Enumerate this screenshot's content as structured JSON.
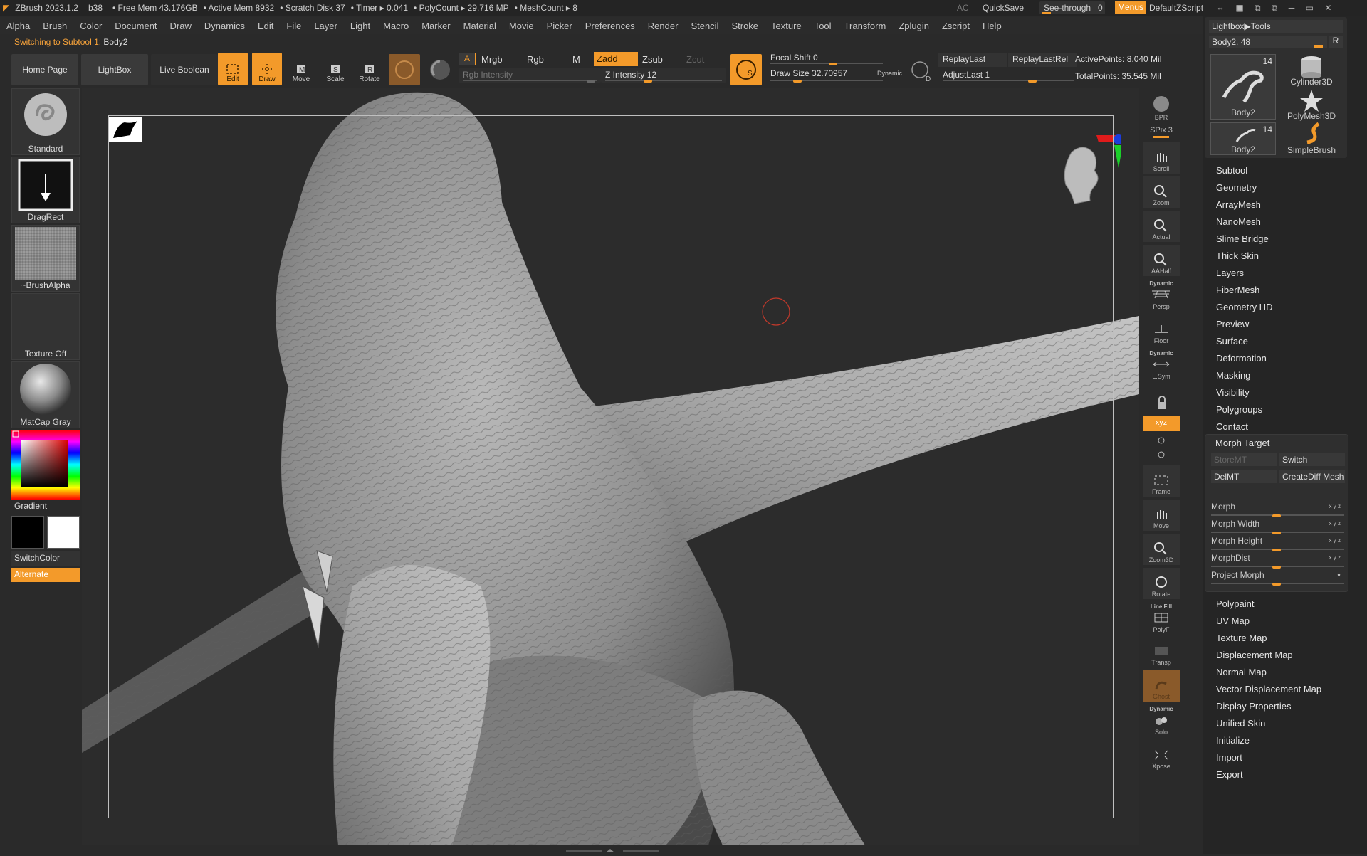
{
  "titlebar": {
    "app": "ZBrush 2023.1.2",
    "build": "b38",
    "free_mem": "• Free Mem 43.176GB",
    "active_mem": "• Active Mem 8932",
    "scratch": "• Scratch Disk 37",
    "timer": "• Timer ▸ 0.041",
    "polycount": "• PolyCount ▸ 29.716 MP",
    "meshcount": "• MeshCount ▸ 8",
    "ac": "AC",
    "quicksave": "QuickSave",
    "seethrough": "See-through",
    "seethrough_value": "0",
    "menus": "Menus",
    "script": "DefaultZScript"
  },
  "menubar": [
    "Alpha",
    "Brush",
    "Color",
    "Document",
    "Draw",
    "Dynamics",
    "Edit",
    "File",
    "Layer",
    "Light",
    "Macro",
    "Marker",
    "Material",
    "Movie",
    "Picker",
    "Preferences",
    "Render",
    "Stencil",
    "Stroke",
    "Texture",
    "Tool",
    "Transform",
    "Zplugin",
    "Zscript",
    "Help"
  ],
  "notice": {
    "text": "Switching to Subtool 1:",
    "subtool": "Body2"
  },
  "toolbar": {
    "home": "Home Page",
    "lightbox": "LightBox",
    "liveboolean": "Live Boolean",
    "edit": "Edit",
    "draw": "Draw",
    "move": "Move",
    "scale": "Scale",
    "rotate": "Rotate",
    "a": "A",
    "mrgb": "Mrgb",
    "rgb": "Rgb",
    "m": "M",
    "rgb_intensity": "Rgb Intensity",
    "zadd": "Zadd",
    "zsub": "Zsub",
    "zcut": "Zcut",
    "z_intensity": "Z Intensity 12",
    "focal_shift": "Focal Shift 0",
    "draw_size": "Draw Size 32.70957",
    "dynamic": "Dynamic",
    "replaylast": "ReplayLast",
    "replaylastrel": "ReplayLastRel",
    "adjustlast": "AdjustLast 1",
    "activepoints": "ActivePoints: 8.040 Mil",
    "totalpoints": "TotalPoints: 35.545 Mil",
    "accent": "#f39a2a"
  },
  "leftshelf": {
    "standard": "Standard",
    "dragrect": "DragRect",
    "brushalpha": "~BrushAlpha",
    "textureoff": "Texture Off",
    "matcap": "MatCap Gray",
    "gradient": "Gradient",
    "switchcolor": "SwitchColor",
    "alternate": "Alternate"
  },
  "rightshelf": {
    "bpr": "BPR",
    "spix": "SPix 3",
    "scroll": "Scroll",
    "zoom": "Zoom",
    "actual": "Actual",
    "aahalf": "AAHalf",
    "dynamic1": "Dynamic",
    "persp": "Persp",
    "floor": "Floor",
    "dynamic2": "Dynamic",
    "lsym": "L.Sym",
    "xyz": "xyz",
    "frame": "Frame",
    "move": "Move",
    "zoom3d": "Zoom3D",
    "rotate": "Rotate",
    "linefill": "Line Fill",
    "polyf": "PolyF",
    "transp": "Transp",
    "ghost": "Ghost",
    "dynamic3": "Dynamic",
    "solo": "Solo",
    "xpose": "Xpose"
  },
  "toolpanel": {
    "lightbox_tools": "Lightbox▶Tools",
    "body2_slider": "Body2. 48",
    "r": "R",
    "thumbs": [
      {
        "label": "Body2",
        "count": "14"
      },
      {
        "label": "Cylinder3D",
        "count": ""
      },
      {
        "label": "PolyMesh3D",
        "count": ""
      },
      {
        "label": "Body2",
        "count": "14"
      },
      {
        "label": "SimpleBrush",
        "count": ""
      }
    ],
    "menu_top": [
      "Subtool",
      "Geometry",
      "ArrayMesh",
      "NanoMesh",
      "Slime Bridge",
      "Thick Skin",
      "Layers",
      "FiberMesh",
      "Geometry HD",
      "Preview",
      "Surface",
      "Deformation",
      "Masking",
      "Visibility",
      "Polygroups",
      "Contact"
    ],
    "morph_target": {
      "title": "Morph Target",
      "storemt": "StoreMT",
      "switch": "Switch",
      "delmt": "DelMT",
      "creatediff": "CreateDiff Mesh",
      "sliders": [
        "Morph",
        "Morph Width",
        "Morph Height",
        "MorphDist",
        "Project Morph"
      ]
    },
    "menu_bottom": [
      "Polypaint",
      "UV Map",
      "Texture Map",
      "Displacement Map",
      "Normal Map",
      "Vector Displacement Map",
      "Display Properties",
      "Unified Skin",
      "Initialize",
      "Import",
      "Export"
    ]
  }
}
